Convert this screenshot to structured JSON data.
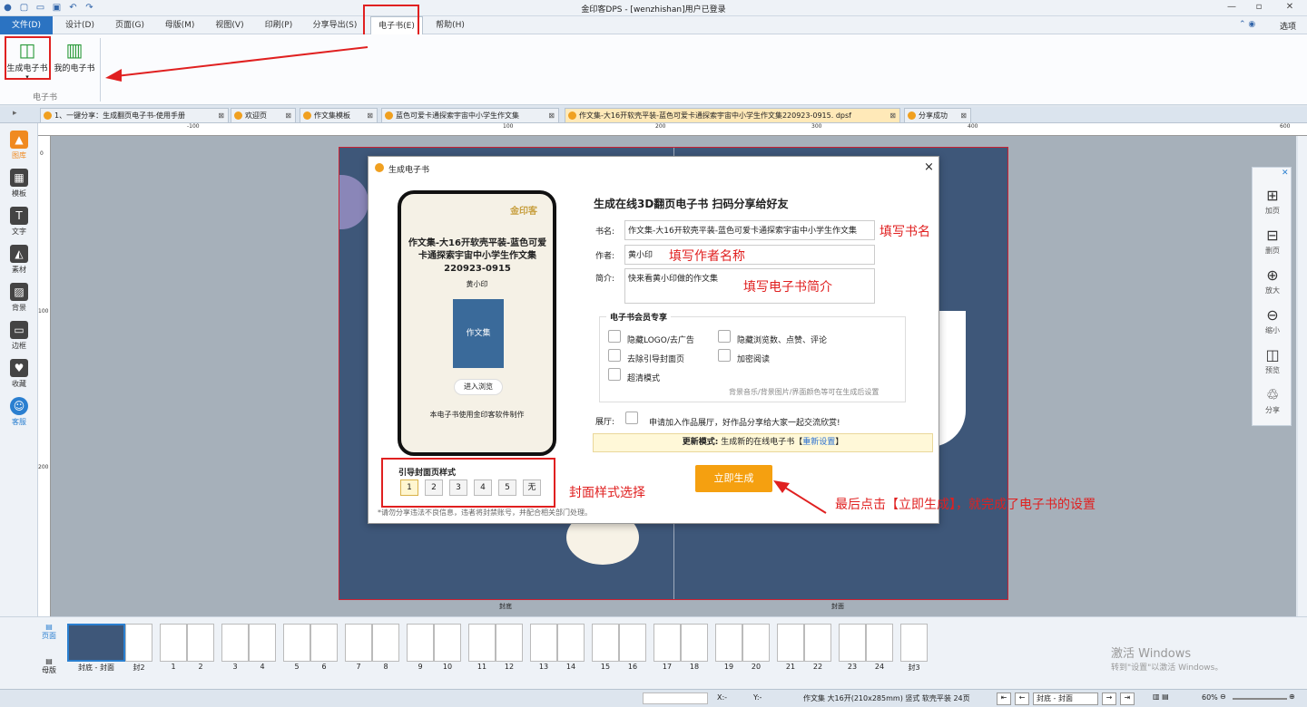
{
  "titlebar": {
    "title": "金印客DPS - [wenzhishan]用户已登录",
    "options_label": "选项"
  },
  "menubar": {
    "items": [
      "文件(D)",
      "设计(D)",
      "页面(G)",
      "母版(M)",
      "视图(V)",
      "印刷(P)",
      "分享导出(S)",
      "电子书(E)",
      "帮助(H)"
    ]
  },
  "ribbon": {
    "generate_label": "生成电子书",
    "mine_label": "我的电子书",
    "group_label": "电子书"
  },
  "tabs": [
    "1、一键分享：生成翻页电子书-使用手册",
    "欢迎页",
    "作文集模板",
    "蓝色可爱卡通探索宇宙中小学生作文集",
    "作文集-大16开软壳平装-蓝色可爱卡通探索宇宙中小学生作文集220923-0915. dpsf",
    "分享成功"
  ],
  "lefttools": [
    "图库",
    "模板",
    "文字",
    "素材",
    "背景",
    "边框",
    "收藏",
    "客服"
  ],
  "ruler": {
    "top_ticks": [
      "-100",
      "100",
      "200",
      "300",
      "400",
      "600"
    ],
    "left_ticks": [
      "0",
      "100",
      "200"
    ]
  },
  "dialog": {
    "title": "生成电子书",
    "close": "×",
    "heading": "生成在线3D翻页电子书 扫码分享给好友",
    "book_label": "书名:",
    "book_value": "作文集-大16开软壳平装-蓝色可爱卡通探索宇宙中小学生作文集",
    "author_label": "作者:",
    "author_value": "黄小印",
    "intro_label": "简介:",
    "intro_value": "快来看黄小印做的作文集",
    "hint_book": "填写书名",
    "hint_author": "填写作者名称",
    "hint_intro": "填写电子书简介",
    "vip_title": "电子书会员专享",
    "vip_hide_logo": "隐藏LOGO/去广告",
    "vip_hide_stats": "隐藏浏览数、点赞、评论",
    "vip_remove_cover": "去除引导封面页",
    "vip_encrypt": "加密阅读",
    "vip_hd": "超清模式",
    "vip_note": "背景音乐/背景图片/界面颜色等可在生成后设置",
    "hall_label": "展厅:",
    "hall_text": "申请加入作品展厅，好作品分享给大家一起交流欣赏!",
    "update_label": "更新模式:",
    "update_text": "生成新的在线电子书【",
    "update_link": "重新设置",
    "update_end": "】",
    "phone_brand": "金印客",
    "phone_title": "作文集-大16开软壳平装-蓝色可爱卡通探索宇宙中小学生作文集220923-0915",
    "phone_author": "黄小印",
    "phone_cover_text": "作文集",
    "phone_enter": "进入浏览",
    "phone_footer": "本电子书使用金印客软件制作",
    "style_title": "引导封面页样式",
    "style_options": [
      "1",
      "2",
      "3",
      "4",
      "5",
      "无"
    ],
    "hint_style": "封面样式选择",
    "generate_button": "立即生成",
    "footer_note": "*请勿分享违法不良信息，违者将封禁账号，并配合相关部门处理。",
    "hint_final": "最后点击【立即生成】，就完成了电子书的设置"
  },
  "rightpanel": [
    "加页",
    "删页",
    "放大",
    "缩小",
    "预览",
    "分享"
  ],
  "thumbs": {
    "side_labels": [
      "页面",
      "母版"
    ],
    "labels": [
      "封底 - 封面",
      "封2",
      "1",
      "2",
      "3",
      "4",
      "5",
      "6",
      "7",
      "8",
      "9",
      "10",
      "11",
      "12",
      "13",
      "14",
      "15",
      "16",
      "17",
      "18",
      "19",
      "20",
      "21",
      "22",
      "23",
      "24",
      "封3"
    ]
  },
  "page_labels": [
    "封底",
    "封面"
  ],
  "watermark": {
    "line1": "激活 Windows",
    "line2": "转到\"设置\"以激活 Windows。"
  },
  "statusbar": {
    "x": "X:-",
    "y": "Y:-",
    "info": "作文集 大16开(210x285mm) 竖式 软壳平装 24页",
    "page_select": "封底 - 封面",
    "zoom": "60%"
  }
}
